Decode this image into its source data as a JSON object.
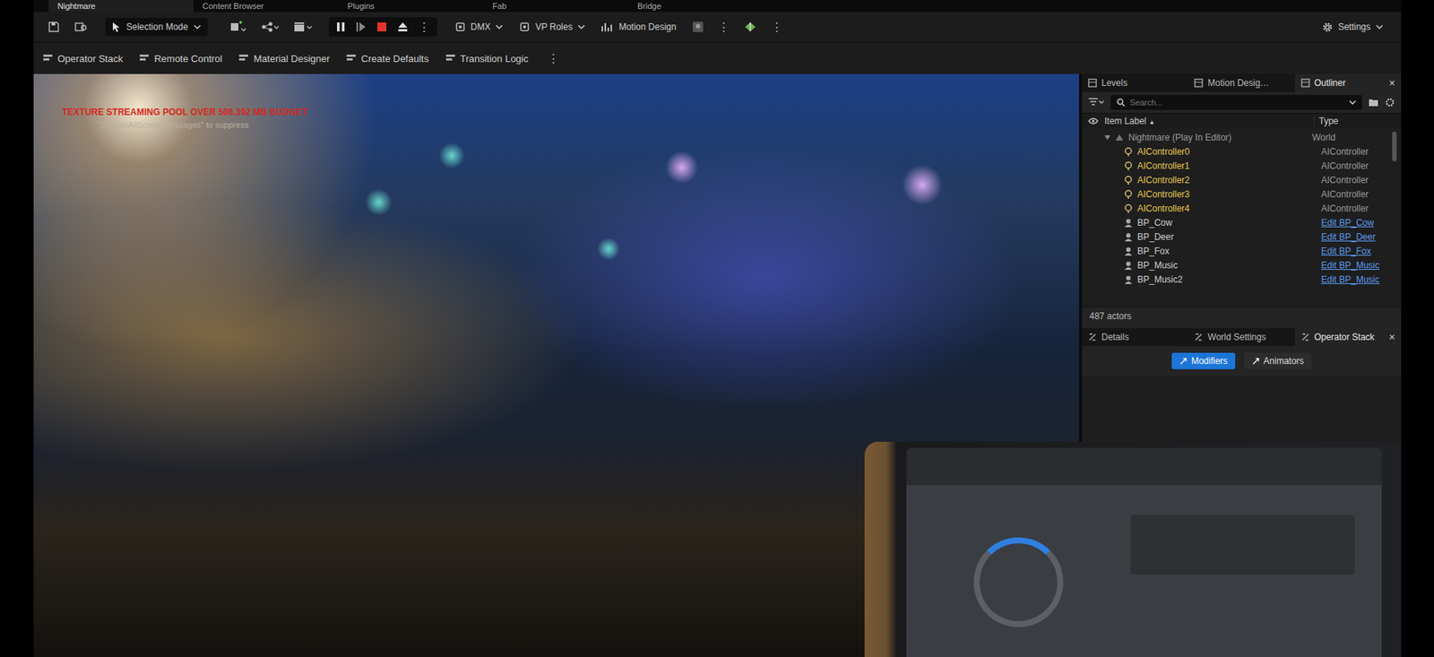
{
  "editor_tabs": [
    {
      "label": "Nightmare",
      "selected": true
    },
    {
      "label": "Content Browser",
      "selected": false
    },
    {
      "label": "Plugins",
      "selected": false
    },
    {
      "label": "Fab",
      "selected": false
    },
    {
      "label": "Bridge",
      "selected": false
    }
  ],
  "main_toolbar": {
    "mode_dropdown": "Selection Mode",
    "play_controls": [
      {
        "kind": "pause"
      },
      {
        "kind": "step"
      },
      {
        "kind": "stop"
      },
      {
        "kind": "eject"
      }
    ],
    "more": "⋮",
    "dropdowns": [
      "DMX",
      "VP Roles"
    ],
    "motion_design": "Motion Design",
    "settings": "Settings"
  },
  "secondary_toolbar": {
    "items": [
      "Operator Stack",
      "Remote Control",
      "Material Designer",
      "Create Defaults",
      "Transition Logic"
    ],
    "more": "⋮"
  },
  "viewport": {
    "messages": [
      {
        "text": "TEXTURE STREAMING POOL OVER 508.392 MB BUDGET",
        "kind": "warning"
      },
      {
        "text": "\"DisableAllScreenMessages\" to suppress",
        "kind": "hint"
      }
    ]
  },
  "outliner": {
    "tabs": [
      {
        "label": "Levels",
        "selected": false
      },
      {
        "label": "Motion Desig…",
        "selected": false
      },
      {
        "label": "Outliner",
        "selected": true
      }
    ],
    "close": "×",
    "search_placeholder": "Search...",
    "columns": {
      "label": "Item Label",
      "sort": "▲",
      "type": "Type"
    },
    "world": {
      "label": "Nightmare (Play In Editor)",
      "type": "World",
      "expanded": true
    },
    "rows": [
      {
        "label": "AIController0",
        "type": "AIController",
        "kind": "controller",
        "link": false
      },
      {
        "label": "AIController1",
        "type": "AIController",
        "kind": "controller",
        "link": false
      },
      {
        "label": "AIController2",
        "type": "AIController",
        "kind": "controller",
        "link": false
      },
      {
        "label": "AIController3",
        "type": "AIController",
        "kind": "controller",
        "link": false
      },
      {
        "label": "AIController4",
        "type": "AIController",
        "kind": "controller",
        "link": false
      },
      {
        "label": "BP_Cow",
        "type": "Edit BP_Cow",
        "kind": "actor",
        "link": true
      },
      {
        "label": "BP_Deer",
        "type": "Edit BP_Deer",
        "kind": "actor",
        "link": true
      },
      {
        "label": "BP_Fox",
        "type": "Edit BP_Fox",
        "kind": "actor",
        "link": true
      },
      {
        "label": "BP_Music",
        "type": "Edit BP_Music",
        "kind": "actor",
        "link": true
      },
      {
        "label": "BP_Music2",
        "type": "Edit BP_Music",
        "kind": "actor",
        "link": true
      }
    ],
    "footer": "487 actors"
  },
  "details": {
    "tabs": [
      {
        "label": "Details",
        "selected": false
      },
      {
        "label": "World Settings",
        "selected": false
      },
      {
        "label": "Operator Stack",
        "selected": true
      }
    ],
    "close": "×",
    "modes": [
      {
        "label": "Modifiers",
        "selected": true
      },
      {
        "label": "Animators",
        "selected": false
      }
    ]
  }
}
